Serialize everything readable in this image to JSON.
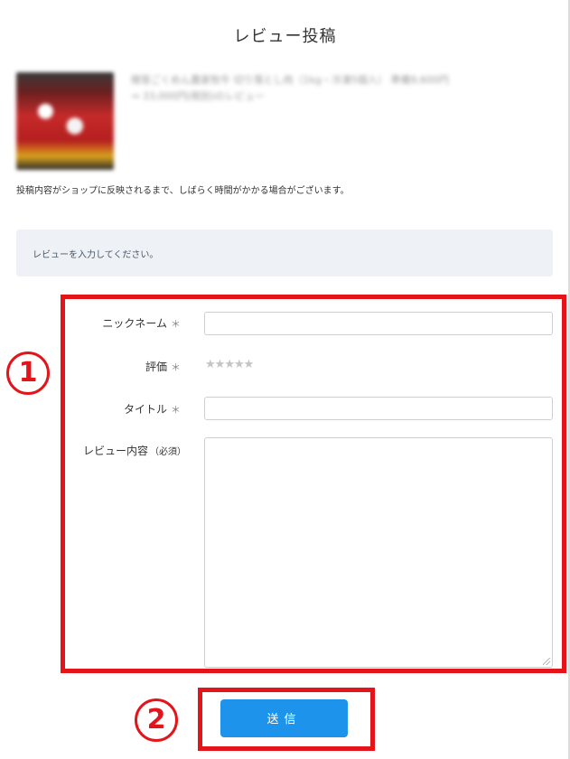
{
  "page": {
    "title": "レビュー投稿"
  },
  "product": {
    "name_line1": "贈答ごくめん農家牧牛 切り落とし肉（1kg・冷凍5個入） 準備9,600円",
    "name_line2": "⇒ 33,000円(税別)のレビュー"
  },
  "notice": "投稿内容がショップに反映されるまで、しばらく時間がかかる場合がございます。",
  "prompt": "レビューを入力してください。",
  "form": {
    "nickname": {
      "label": "ニックネーム",
      "required_mark": "＊",
      "value": ""
    },
    "rating": {
      "label": "評価",
      "required_mark": "＊",
      "stars": [
        "★",
        "★",
        "★",
        "★",
        "★"
      ]
    },
    "title": {
      "label": "タイトル",
      "required_mark": "＊",
      "value": ""
    },
    "body": {
      "label": "レビュー内容",
      "required_mark": "（必須）",
      "value": ""
    },
    "submit_label": "送信"
  },
  "annotations": {
    "box1_number": "1",
    "box2_number": "2",
    "color": "#e4141b"
  },
  "colors": {
    "submit": "#1e93ec",
    "prompt_bg": "#eef1f5"
  }
}
